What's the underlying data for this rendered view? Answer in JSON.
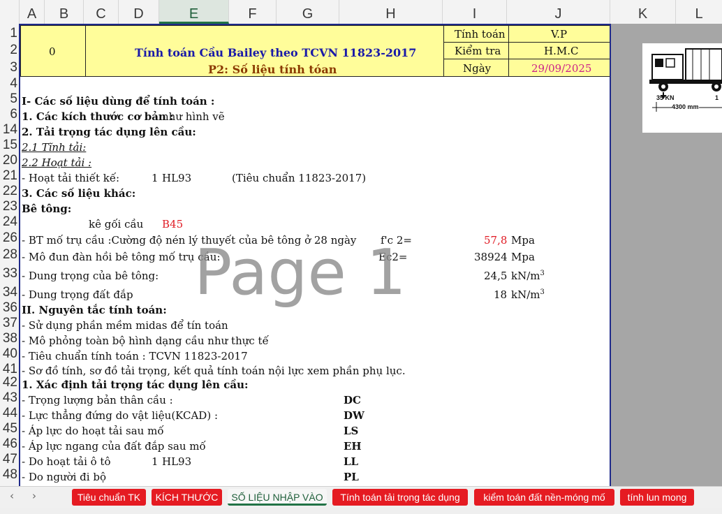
{
  "columns": [
    "A",
    "B",
    "C",
    "D",
    "E",
    "F",
    "G",
    "H",
    "I",
    "J",
    "K",
    "L"
  ],
  "rows": [
    "1",
    "2",
    "3",
    "4",
    "5",
    "6",
    "14",
    "15",
    "20",
    "21",
    "22",
    "23",
    "24",
    "26",
    "28",
    "33",
    "34",
    "36",
    "37",
    "38",
    "40",
    "41",
    "42",
    "43",
    "44",
    "45",
    "46",
    "47",
    "48"
  ],
  "title_block": {
    "number": "0",
    "title": "Tính toán Cầu Bailey theo TCVN 11823-2017",
    "subtitle": "P2: Số liệu tính tóan",
    "labels": [
      "Tính toán",
      "Kiểm tra",
      "Ngày"
    ],
    "values": [
      "V.P",
      "H.M.C",
      "29/09/2025"
    ]
  },
  "content": {
    "r5": "I- Các số liệu dùng để tính toán :",
    "r6a": "1. Các kích thước cơ bản :",
    "r6b": "như hình vẽ",
    "r14": "2. Tải trọng tác dụng lên cầu:",
    "r15": "2.1 Tĩnh tải:",
    "r20": "2.2 Hoạt tải :",
    "r21a": "- Hoạt tải thiết kế:",
    "r21b": "1",
    "r21c": "HL93",
    "r21d": "(Tiêu chuẩn 11823-2017)",
    "r22": "3. Các số liệu khác:",
    "r23": "Bê tông:",
    "r24a": "kê gối cầu",
    "r24b": "B45",
    "r26a": "- BT mố trụ cầu :Cường độ nén  lý thuyết của bê tông ở 28 ngày",
    "r26b": "f'c 2=",
    "r26c": "57,8",
    "r26d": "Mpa",
    "r28a": "- Mô đun đàn hồi bê tông mố trụ cầu:",
    "r28b": "Ec2=",
    "r28c": "38924",
    "r28d": "Mpa",
    "r33a": "- Dung trọng của bê tông:",
    "r33c": "24,5",
    "r33d": "kN/m",
    "r34a": "- Dung trọng đất đắp",
    "r34c": "18",
    "r34d": "kN/m",
    "sup": "3",
    "r36": "II. Nguyên tắc tính toán:",
    "r37": "- Sử dụng phần mềm midas để tín toán",
    "r38": "- Mô phỏng toàn bộ hình dạng cầu như thực tế",
    "r40": "- Tiêu chuẩn tính toán : TCVN 11823-2017",
    "r41": "- Sơ đồ tính, sơ đồ tải trọng, kết quả tính toán nội lực xem phần phụ lục.",
    "r42": "1. Xác định tải trọng tác dụng lên cầu:",
    "r43a": "- Trọng lượng bản thân cầu :",
    "r43b": "DC",
    "r44a": "- Lực thẳng đứng do vật liệu(KCAD)   :",
    "r44b": "DW",
    "r45a": "- Áp lực do hoạt tải sau mố",
    "r45b": "LS",
    "r46a": "- Áp lực ngang của đất đắp sau mố",
    "r46b": "EH",
    "r47a": "- Do hoạt tải ô tô",
    "r47b": "1",
    "r47c": "HL93",
    "r47d": "LL",
    "r48a": "- Do người đi bộ",
    "r48b": "PL"
  },
  "watermark": "Page 1",
  "truck": {
    "load": "35 KN",
    "spacing": "4300 mm",
    "partial": "1"
  },
  "tabs": [
    "Tiêu chuẩn TK",
    "KÍCH THƯỚC",
    "SỐ LIỆU NHẬP VÀO",
    "Tính toán tải trọng tác dụng",
    "kiểm toán đất nền-móng mố",
    "tính lun mong"
  ],
  "active_tab": "SỐ LIỆU NHẬP VÀO",
  "nav": {
    "prev": "‹",
    "next": "›"
  },
  "colors": {
    "accent": "#217346",
    "tab_red": "#e51b22",
    "yellow": "#fffd9a",
    "border_blue": "#1f2a8a",
    "title_blue": "#1a1aa8",
    "subtitle_brown": "#8b3a00",
    "value_red": "#e01b24",
    "date_magenta": "#cc2288"
  }
}
